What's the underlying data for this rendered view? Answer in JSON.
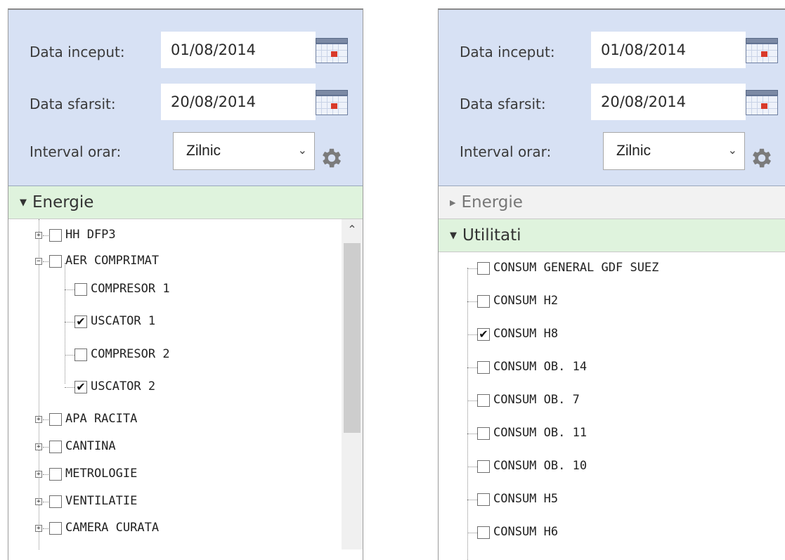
{
  "left": {
    "start_label": "Data inceput:",
    "start_value": "01/08/2014",
    "end_label": "Data sfarsit:",
    "end_value": "20/08/2014",
    "interval_label": "Interval orar:",
    "interval_value": "Zilnic",
    "section": "Energie",
    "tree": [
      {
        "label": "HH DFP3",
        "checked": false,
        "expander": "+"
      },
      {
        "label": "AER COMPRIMAT",
        "checked": false,
        "expander": "-"
      },
      {
        "label": "COMPRESOR 1",
        "checked": false
      },
      {
        "label": "USCATOR 1",
        "checked": true
      },
      {
        "label": "COMPRESOR 2",
        "checked": false
      },
      {
        "label": "USCATOR 2",
        "checked": true
      },
      {
        "label": "APA RACITA",
        "checked": false,
        "expander": "+"
      },
      {
        "label": "CANTINA",
        "checked": false,
        "expander": "+"
      },
      {
        "label": "METROLOGIE",
        "checked": false,
        "expander": "+"
      },
      {
        "label": "VENTILATIE",
        "checked": false,
        "expander": "+"
      },
      {
        "label": "CAMERA CURATA",
        "checked": false,
        "expander": "+"
      }
    ]
  },
  "right": {
    "start_label": "Data inceput:",
    "start_value": "01/08/2014",
    "end_label": "Data sfarsit:",
    "end_value": "20/08/2014",
    "interval_label": "Interval orar:",
    "interval_value": "Zilnic",
    "section_collapsed": "Energie",
    "section_active": "Utilitati",
    "tree": [
      {
        "label": "CONSUM GENERAL GDF SUEZ",
        "checked": false
      },
      {
        "label": "CONSUM H2",
        "checked": false
      },
      {
        "label": "CONSUM H8",
        "checked": true
      },
      {
        "label": "CONSUM OB. 14",
        "checked": false
      },
      {
        "label": "CONSUM OB. 7",
        "checked": false
      },
      {
        "label": "CONSUM OB. 11",
        "checked": false
      },
      {
        "label": "CONSUM OB. 10",
        "checked": false
      },
      {
        "label": "CONSUM H5",
        "checked": false
      },
      {
        "label": "CONSUM H6",
        "checked": false
      }
    ]
  },
  "icons": {
    "calendar": "calendar-icon",
    "gear": "gear-icon",
    "dropdown": "chevron-down-icon",
    "expanded_arrow": "caret-down-icon",
    "collapsed_arrow": "caret-right-icon",
    "scroll_up": "chevron-up-icon"
  },
  "colors": {
    "filter_bg": "#d7e1f4",
    "active_section_bg": "#dff3dd",
    "inactive_section_bg": "#f2f2f2"
  }
}
